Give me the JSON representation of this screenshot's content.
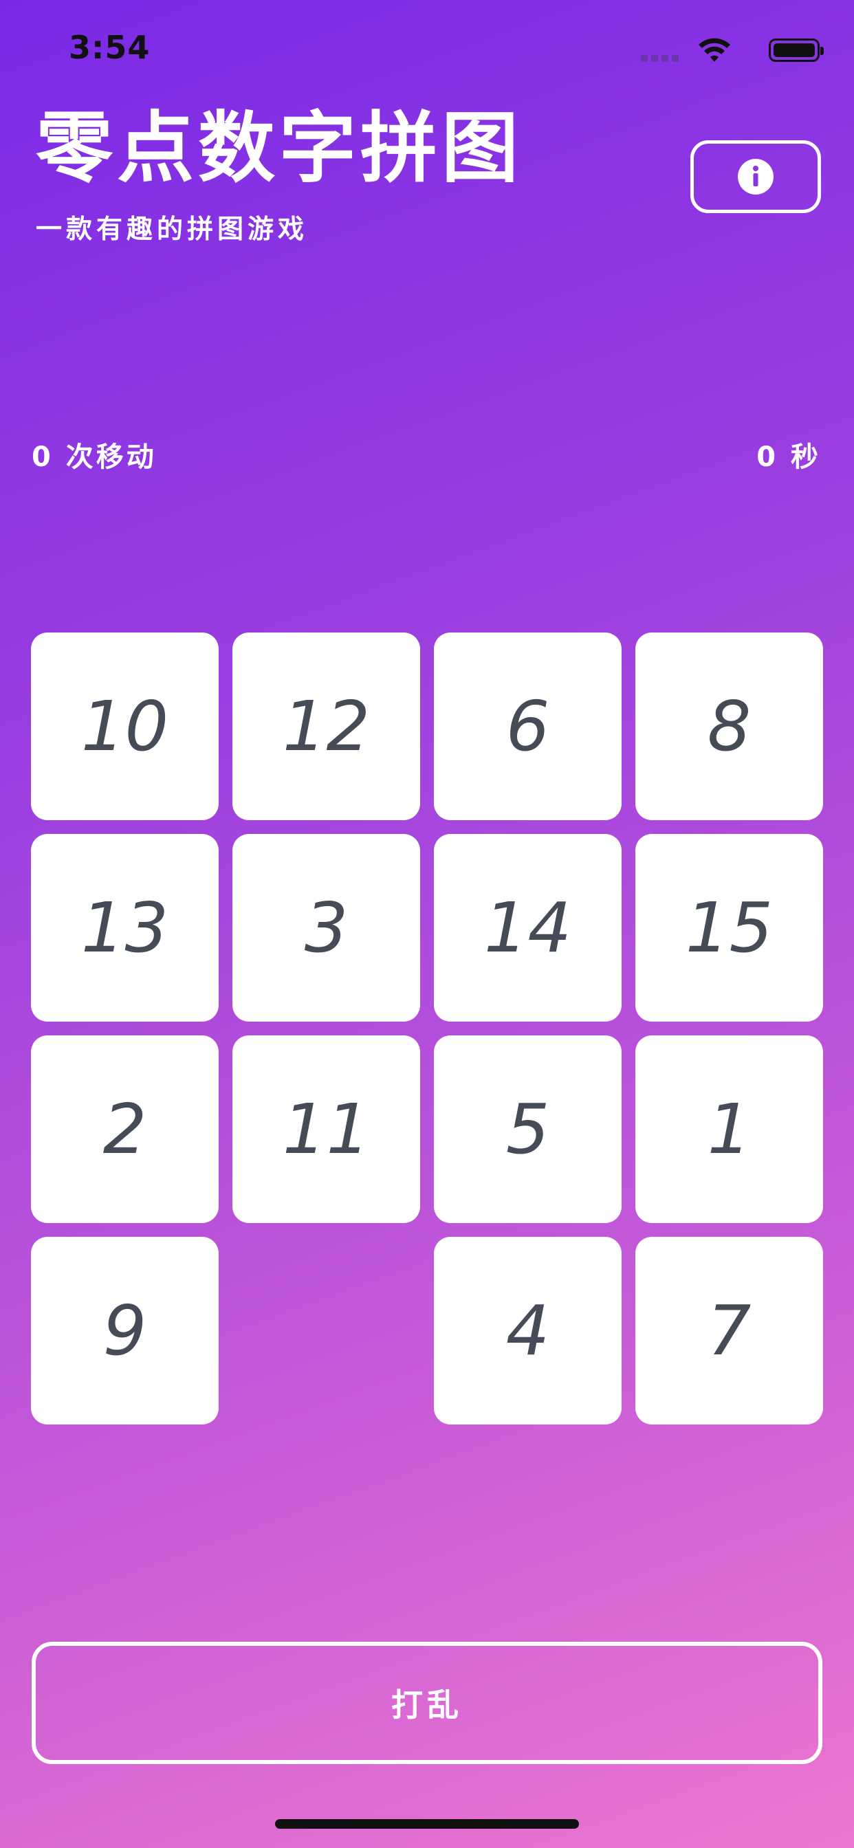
{
  "status_bar": {
    "time": "3:54"
  },
  "header": {
    "title": "零点数字拼图",
    "subtitle": "一款有趣的拼图游戏",
    "info_icon": "info-icon"
  },
  "stats": {
    "moves_label": "0 次移动",
    "time_label": "0 秒"
  },
  "board": {
    "tiles": [
      "10",
      "12",
      "6",
      "8",
      "13",
      "3",
      "14",
      "15",
      "2",
      "11",
      "5",
      "1",
      "9",
      "",
      "4",
      "7"
    ]
  },
  "actions": {
    "shuffle_label": "打乱"
  },
  "colors": {
    "gradient_start": "#7a2ae6",
    "gradient_end": "#ec76cf",
    "tile_background": "#ffffff",
    "tile_text": "#454c57"
  }
}
